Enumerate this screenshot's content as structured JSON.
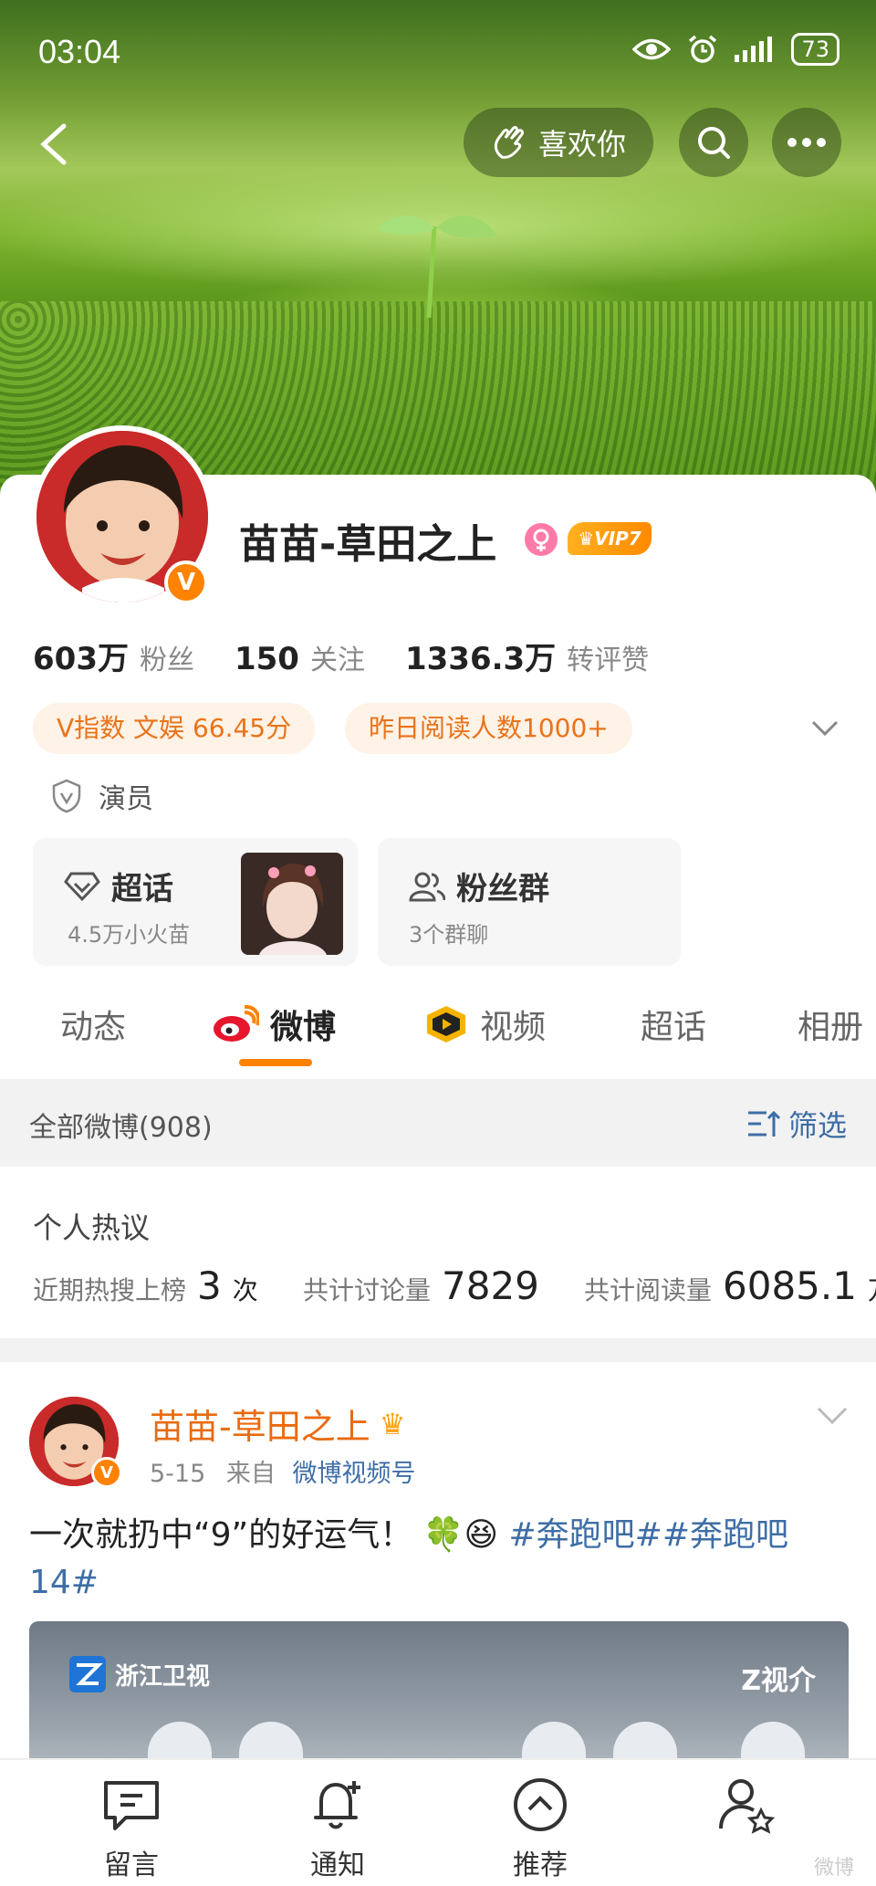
{
  "status_bar": {
    "time": "03:04",
    "battery": "73"
  },
  "header": {
    "like_button": "喜欢你"
  },
  "profile": {
    "name": "苗苗-草田之上",
    "vip_badge": "VIP7",
    "stats": [
      {
        "value": "603万",
        "label": "粉丝"
      },
      {
        "value": "150",
        "label": "关注"
      },
      {
        "value": "1336.3万",
        "label": "转评赞"
      }
    ],
    "tags": [
      "V指数 文娱 66.45分",
      "昨日阅读人数1000+"
    ],
    "occupation": "演员",
    "super_topic": {
      "title": "超话",
      "subtitle": "4.5万小火苗"
    },
    "fan_group": {
      "title": "粉丝群",
      "subtitle": "3个群聊"
    }
  },
  "tabs": [
    "动态",
    "微博",
    "视频",
    "超话",
    "相册"
  ],
  "filter_bar": {
    "all_posts": "全部微博(908)",
    "filter": "筛选"
  },
  "hot_discussion": {
    "title": "个人热议",
    "items": [
      {
        "label": "近期热搜上榜",
        "value": "3",
        "unit": "次"
      },
      {
        "label": "共计讨论量",
        "value": "7829",
        "unit": ""
      },
      {
        "label": "共计阅读量",
        "value": "6085.1",
        "unit": "万"
      }
    ]
  },
  "post": {
    "author": "苗苗-草田之上",
    "date": "5-15",
    "from_label": "来自",
    "source": "微博视频号",
    "text_plain": "一次就扔中“9”的好运气！",
    "emoji": "🍀😆",
    "topic1": "#奔跑吧#",
    "topic2": "#奔跑吧14#",
    "image_logo_left": "浙江卫视",
    "image_logo_right": "Z视介"
  },
  "bottom_nav": [
    "留言",
    "通知",
    "推荐",
    ""
  ],
  "watermark": "微博"
}
